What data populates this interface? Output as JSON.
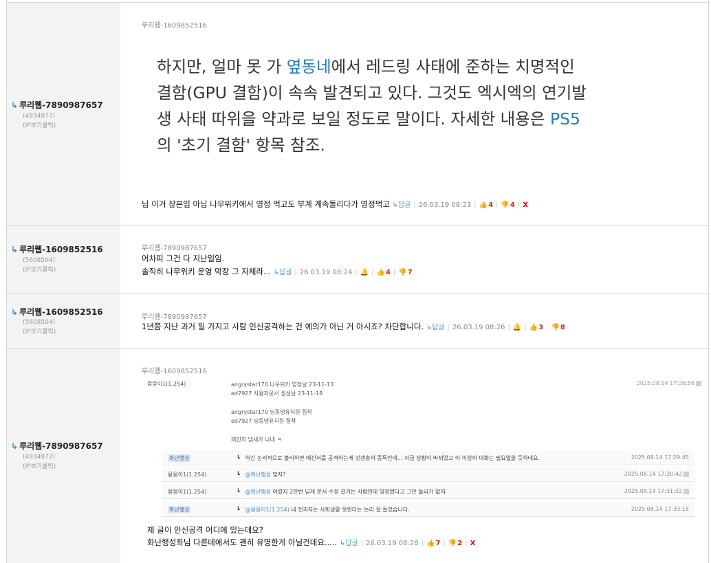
{
  "comments": [
    {
      "author": "루리웹-7890987657",
      "id_num": "(4934977)",
      "ip": "(IP보기클릭)",
      "reply_to": "루리웹-1609852516",
      "quote_lines": [
        [
          "하지만, 얼마 못 가 ",
          "옆동네",
          "에서 레드링 사태에 준하는 치명적인"
        ],
        [
          "결함(GPU 결함)이 속속 발견되고 있다. 그것도 엑시엑의 연기발"
        ],
        [
          "생 사태 따위을 약과로 보일 정도로 말이다. 자세한 내용은 ",
          "PS5"
        ],
        [
          "의 '초기 결함' 항목 참조."
        ]
      ],
      "text": "님 이거 장본임 아님 나무위키에서 영정 먹고도 부계 계속돌리다가 영정먹고",
      "reply_label": "답글",
      "date": "26.03.19 08:23",
      "up": "4",
      "down": "4",
      "delete": "X"
    },
    {
      "author": "루리웹-1609852516",
      "id_num": "(5608504)",
      "ip": "(IP보기클릭)",
      "reply_to": "루리웹-7890987657",
      "line1": "어차피 그건 다 지난일임.",
      "line2": "솔직히 나무위키 운영 막장 그 자체라...",
      "reply_label": "답글",
      "date": "26.03.19 08:24",
      "up": "4",
      "down": "7"
    },
    {
      "author": "루리웹-1609852516",
      "id_num": "(5608504)",
      "ip": "(IP보기클릭)",
      "reply_to": "루리웹-7890987657",
      "text": "1년쯤 지난 과거 일 가지고 사람 인신공격하는 건 예의가 아닌 거 아시죠? 차단합니다.",
      "reply_label": "답글",
      "date": "26.03.19 08:26",
      "up": "3",
      "down": "8"
    },
    {
      "author": "루리웹-7890987657",
      "id_num": "(4934977)",
      "ip": "(IP보기클릭)",
      "reply_to": "루리웹-1609852516",
      "embed": {
        "main_name": "뮴뭉이1(1.254)",
        "main_lines": [
          "angrystar170 나무위키 영정날 23-11-13",
          "ed7927 사용자문서 생성날 23-11-18",
          "",
          "angrystar170 딩동댕유치원 집착",
          "ed7927 딩동댕유치원 집착",
          "",
          "왜인지 냄새가 나네 ㅋ"
        ],
        "main_time": "2025.08.14 17:26:56",
        "replies": [
          {
            "name": "화난행성",
            "body": "하긴 논리적으로 불리하면 메신저를 공격하는게 갓갬충의 종특인데... 지금 상황이 바뀌었고 이 이상의 대화는 필요없을 듯하네요.",
            "at": "",
            "time": "2025.08.14 17:29:45"
          },
          {
            "name": "뮴뭉이1(1.254)",
            "at": "@화난행성",
            "body": " 맞지?",
            "time": "2025.08.14 17:30:42"
          },
          {
            "name": "뮴뭉이1(1.254)",
            "at": "@화난행성",
            "body": " 어렸지 2만번 넘게 문서 수정 갈기는 사람인데 영정됐다고 그만 둘리가 없지",
            "time": "2025.08.14 17:31:32"
          },
          {
            "name": "화난행성",
            "at": "@뮴뭉이1(1.254)",
            "body": " 네 전과자는 사회생활 못한다는 논리 잘 들었습니다.",
            "time": "2025.08.14 17:33:15"
          }
        ]
      },
      "line1": "제 글이 인신공격 어디에 있는데요?",
      "line2": "화난행성좌님 다른데에서도 괜히 유명한게 아닐건데요.....",
      "reply_label": "답글",
      "date": "26.03.19 08:28",
      "up": "7",
      "down": "2",
      "delete": "X"
    }
  ]
}
